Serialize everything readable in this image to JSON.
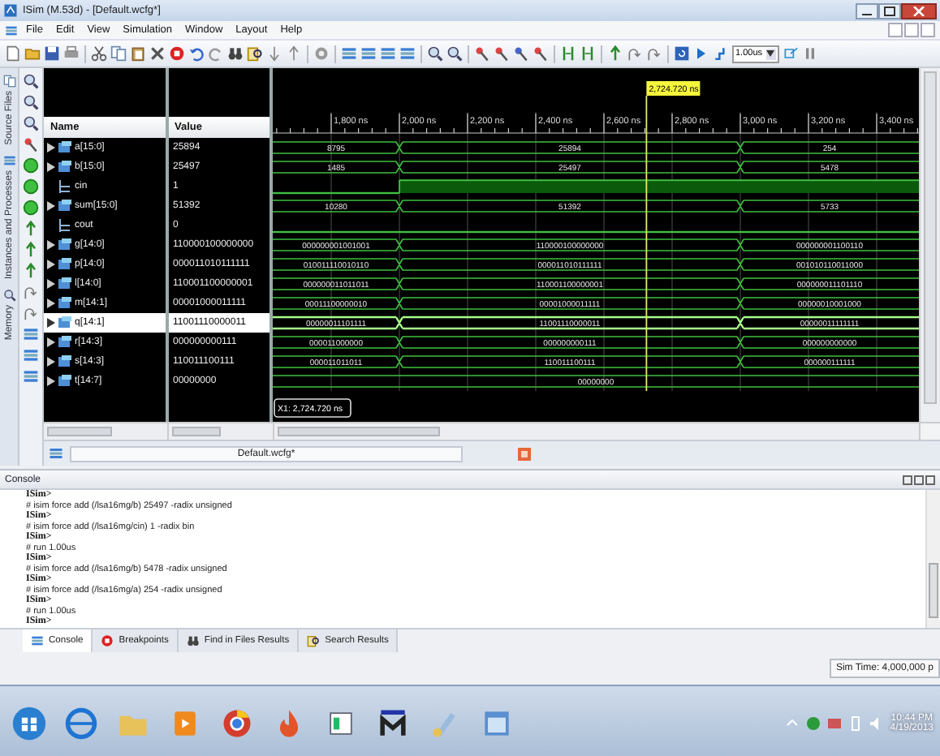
{
  "window": {
    "title": "ISim (M.53d) - [Default.wcfg*]"
  },
  "menu": [
    "File",
    "Edit",
    "View",
    "Simulation",
    "Window",
    "Layout",
    "Help"
  ],
  "toolbar": {
    "time_field": "1.00us"
  },
  "side_tabs": [
    "Source Files",
    "Instances and Processes",
    "Memory"
  ],
  "wave": {
    "columns": [
      "Name",
      "Value"
    ],
    "cursor": "2,724.720 ns",
    "marker": "X1: 2,724.720 ns",
    "ticks": [
      "1,800 ns",
      "2,000 ns",
      "2,200 ns",
      "2,400 ns",
      "2,600 ns",
      "2,800 ns",
      "3,000 ns",
      "3,200 ns",
      "3,400 ns"
    ],
    "signals": [
      {
        "name": "a[15:0]",
        "kind": "bus",
        "value": "25894",
        "selected": false,
        "segments": [
          {
            "text": "8795"
          },
          {
            "text": "25894"
          },
          {
            "text": "254"
          }
        ]
      },
      {
        "name": "b[15:0]",
        "kind": "bus",
        "value": "25497",
        "selected": false,
        "segments": [
          {
            "text": "1485"
          },
          {
            "text": "25497"
          },
          {
            "text": "5478"
          }
        ]
      },
      {
        "name": "cin",
        "kind": "bit",
        "value": "1",
        "selected": false,
        "segments": [
          {
            "high": false
          },
          {
            "high": true
          },
          {
            "high": true
          }
        ]
      },
      {
        "name": "sum[15:0]",
        "kind": "bus",
        "value": "51392",
        "selected": false,
        "segments": [
          {
            "text": "10280"
          },
          {
            "text": "51392"
          },
          {
            "text": "5733"
          }
        ]
      },
      {
        "name": "cout",
        "kind": "bit",
        "value": "0",
        "selected": false,
        "segments": [
          {
            "high": false
          },
          {
            "high": false
          },
          {
            "high": false
          }
        ]
      },
      {
        "name": "g[14:0]",
        "kind": "bus",
        "value": "110000100000000",
        "selected": false,
        "segments": [
          {
            "text": "000000001001001"
          },
          {
            "text": "110000100000000"
          },
          {
            "text": "000000001100110"
          }
        ]
      },
      {
        "name": "p[14:0]",
        "kind": "bus",
        "value": "000011010111111",
        "selected": false,
        "segments": [
          {
            "text": "010011110010110"
          },
          {
            "text": "000011010111111"
          },
          {
            "text": "001010110011000"
          }
        ]
      },
      {
        "name": "l[14:0]",
        "kind": "bus",
        "value": "110001100000001",
        "selected": false,
        "segments": [
          {
            "text": "000000011011011"
          },
          {
            "text": "110001100000001"
          },
          {
            "text": "000000011101110"
          }
        ]
      },
      {
        "name": "m[14:1]",
        "kind": "bus",
        "value": "00001000011111",
        "selected": false,
        "segments": [
          {
            "text": "00011100000010"
          },
          {
            "text": "00001000011111"
          },
          {
            "text": "00000010001000"
          }
        ]
      },
      {
        "name": "q[14:1]",
        "kind": "bus",
        "value": "11001110000011",
        "selected": true,
        "segments": [
          {
            "text": "00000011101111"
          },
          {
            "text": "11001110000011"
          },
          {
            "text": "00000011111111"
          }
        ]
      },
      {
        "name": "r[14:3]",
        "kind": "bus",
        "value": "000000000111",
        "selected": false,
        "segments": [
          {
            "text": "000011000000"
          },
          {
            "text": "000000000111"
          },
          {
            "text": "000000000000"
          }
        ]
      },
      {
        "name": "s[14:3]",
        "kind": "bus",
        "value": "110011100111",
        "selected": false,
        "segments": [
          {
            "text": "000011011011"
          },
          {
            "text": "110011100111"
          },
          {
            "text": "000000111111"
          }
        ]
      },
      {
        "name": "t[14:7]",
        "kind": "bus",
        "value": "00000000",
        "selected": false,
        "segments": [
          {
            "text": "00000000"
          }
        ]
      }
    ]
  },
  "editor_tab": "Default.wcfg*",
  "console": {
    "title": "Console",
    "lines": [
      {
        "kind": "prompt",
        "text": "ISim>"
      },
      {
        "kind": "command",
        "text": "# isim force add (/lsa16mg/b) 25497 -radix unsigned"
      },
      {
        "kind": "prompt",
        "text": "ISim>"
      },
      {
        "kind": "command",
        "text": "# isim force add (/lsa16mg/cin) 1 -radix bin"
      },
      {
        "kind": "prompt",
        "text": "ISim>"
      },
      {
        "kind": "command",
        "text": "# run 1.00us"
      },
      {
        "kind": "prompt",
        "text": "ISim>"
      },
      {
        "kind": "command",
        "text": "# isim force add (/lsa16mg/b) 5478 -radix unsigned"
      },
      {
        "kind": "prompt",
        "text": "ISim>"
      },
      {
        "kind": "command",
        "text": "# isim force add (/lsa16mg/a) 254 -radix unsigned"
      },
      {
        "kind": "prompt",
        "text": "ISim>"
      },
      {
        "kind": "command",
        "text": "# run 1.00us"
      },
      {
        "kind": "prompt",
        "text": "ISim>"
      }
    ]
  },
  "bottom_tabs": [
    {
      "label": "Console",
      "selected": true
    },
    {
      "label": "Breakpoints",
      "selected": false
    },
    {
      "label": "Find in Files Results",
      "selected": false
    },
    {
      "label": "Search Results",
      "selected": false
    }
  ],
  "status": "Sim Time: 4,000,000 p",
  "taskbar": {
    "time": "10:44 PM",
    "date": "4/19/2013"
  }
}
